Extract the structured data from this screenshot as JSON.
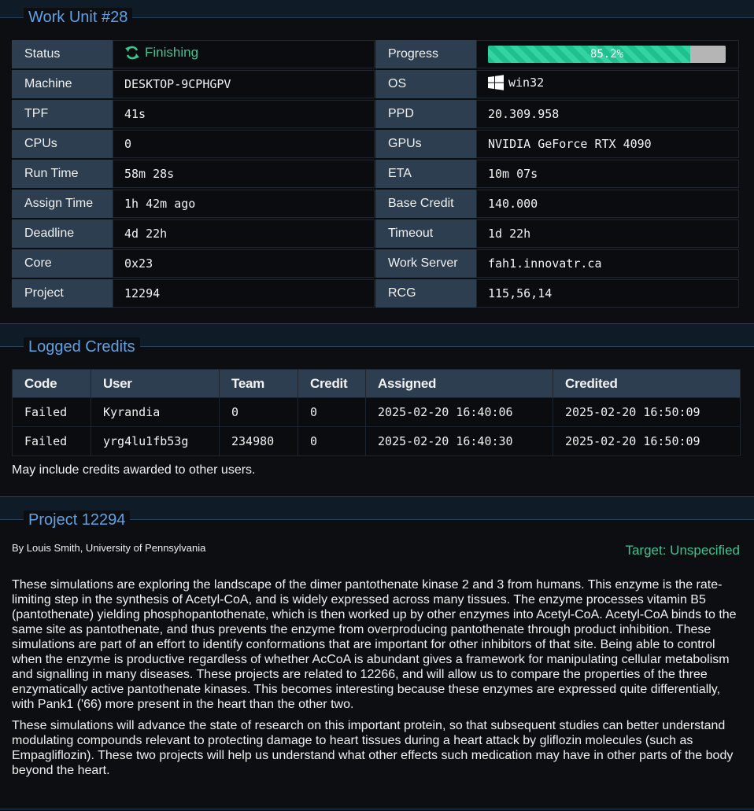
{
  "work_unit": {
    "title": "Work Unit #28",
    "status_label": "Status",
    "status_value": "Finishing",
    "progress_label": "Progress",
    "progress_text": "85.2%",
    "progress_fraction": 0.852,
    "machine_label": "Machine",
    "machine_value": "DESKTOP-9CPHGPV",
    "os_label": "OS",
    "os_value": "win32",
    "tpf_label": "TPF",
    "tpf_value": "41s",
    "ppd_label": "PPD",
    "ppd_value": "20.309.958",
    "cpus_label": "CPUs",
    "cpus_value": "0",
    "gpus_label": "GPUs",
    "gpus_value": "NVIDIA GeForce RTX 4090",
    "runtime_label": "Run Time",
    "runtime_value": "58m 28s",
    "eta_label": "ETA",
    "eta_value": "10m 07s",
    "assign_label": "Assign Time",
    "assign_value": "1h 42m ago",
    "basecredit_label": "Base Credit",
    "basecredit_value": "140.000",
    "deadline_label": "Deadline",
    "deadline_value": "4d 22h",
    "timeout_label": "Timeout",
    "timeout_value": "1d 22h",
    "core_label": "Core",
    "core_value": "0x23",
    "workserver_label": "Work Server",
    "workserver_value": "fah1.innovatr.ca",
    "project_label": "Project",
    "project_value": "12294",
    "rcg_label": "RCG",
    "rcg_value": "115,56,14"
  },
  "credits": {
    "title": "Logged Credits",
    "headers": [
      "Code",
      "User",
      "Team",
      "Credit",
      "Assigned",
      "Credited"
    ],
    "rows": [
      [
        "Failed",
        "Kyrandia",
        "0",
        "0",
        "2025-02-20 16:40:06",
        "2025-02-20 16:50:09"
      ],
      [
        "Failed",
        "yrg4lu1fb53g",
        "234980",
        "0",
        "2025-02-20 16:40:30",
        "2025-02-20 16:50:09"
      ]
    ],
    "note": "May include credits awarded to other users."
  },
  "project": {
    "title": "Project 12294",
    "byline": "By Louis Smith, University of Pennsylvania",
    "target": "Target: Unspecified",
    "paragraph1": "These simulations are exploring the landscape of the dimer pantothenate kinase 2 and 3 from humans. This enzyme is the rate-limiting step in the synthesis of Acetyl-CoA, and is widely expressed across many tissues. The enzyme processes vitamin B5 (pantothenate) yielding phosphopantothenate, which is then worked up by other enzymes into Acetyl-CoA. Acetyl-CoA binds to the same site as pantothenate, and thus prevents the enzyme from overproducing pantothenate through product inhibition. These simulations are part of an effort to identify conformations that are important for other inhibitors of that site. Being able to control when the enzyme is productive regardless of whether AcCoA is abundant gives a framework for manipulating cellular metabolism and signalling in many diseases. These projects are related to 12266, and will allow us to compare the properties of the three enzymatically active pantothenate kinases. This becomes interesting because these enzymes are expressed quite differentially, with Pank1 ('66) more present in the heart than the other two.",
    "paragraph2": "These simulations will advance the state of research on this important protein, so that subsequent studies can better understand modulating compounds relevant to protecting damage to heart tissues during a heart attack by gliflozin molecules (such as Empagliflozin). These two projects will help us understand what other effects such medication may have in other parts of the body beyond the heart."
  },
  "colors": {
    "accent": "#5ea2e6",
    "success": "#3fc38f",
    "label_bg": "#2c3e50",
    "page_bg": "#0c0e12"
  },
  "icons": {
    "status": "refresh-icon",
    "os": "windows-icon"
  }
}
